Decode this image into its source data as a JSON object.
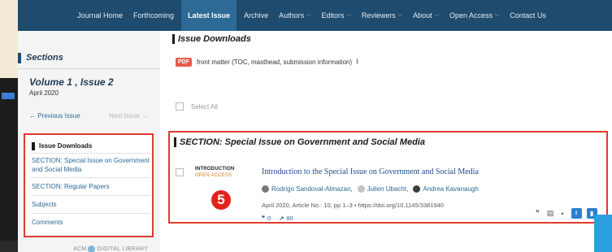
{
  "nav": {
    "items": [
      {
        "label": "Journal Home",
        "active": false,
        "dropdown": false
      },
      {
        "label": "Forthcoming",
        "active": false,
        "dropdown": false
      },
      {
        "label": "Latest Issue",
        "active": true,
        "dropdown": false
      },
      {
        "label": "Archive",
        "active": false,
        "dropdown": false
      },
      {
        "label": "Authors",
        "active": false,
        "dropdown": true
      },
      {
        "label": "Editors",
        "active": false,
        "dropdown": true
      },
      {
        "label": "Reviewers",
        "active": false,
        "dropdown": true
      },
      {
        "label": "About",
        "active": false,
        "dropdown": true
      },
      {
        "label": "Open Access",
        "active": false,
        "dropdown": true
      },
      {
        "label": "Contact Us",
        "active": false,
        "dropdown": false
      }
    ]
  },
  "sidebar": {
    "sections_title": "Sections",
    "volume_title": "Volume 1 , Issue 2",
    "issue_date": "April 2020",
    "prev_issue": "← Previous Issue",
    "next_issue": "Next Issue →",
    "toc_items": [
      "Issue Downloads",
      "SECTION: Special Issue on Government and Social Media",
      "SECTION: Regular Papers",
      "Subjects",
      "Comments"
    ],
    "logo_text_left": "ACM",
    "logo_text_right": "DIGITAL LIBRARY"
  },
  "main": {
    "downloads_title": "Issue Downloads",
    "pdf_badge": "PDF",
    "front_matter": "front matter (TOC, masthead, submission information)",
    "select_all": "Select All",
    "section_title": "SECTION: Special Issue on Government and Social Media",
    "article": {
      "type": "INTRODUCTION",
      "access": "OPEN ACCESS",
      "title": "Introduction to the Special Issue on Government and Social Media",
      "authors": [
        "Rodrigo Sandoval-Almazan,",
        "Julien Ubacht,",
        "Andrea Kavanaugh"
      ],
      "meta": "April 2020, Article No.: 10, pp 1–3 • https://doi.org/10.1145/3381940",
      "citations": "0",
      "downloads": "80"
    },
    "marker": "5"
  },
  "colors": {
    "nav_bg": "#1e4b6e",
    "highlight_red": "#e23a2e",
    "link_blue": "#2d6a96",
    "open_access_orange": "#e07e1a"
  }
}
